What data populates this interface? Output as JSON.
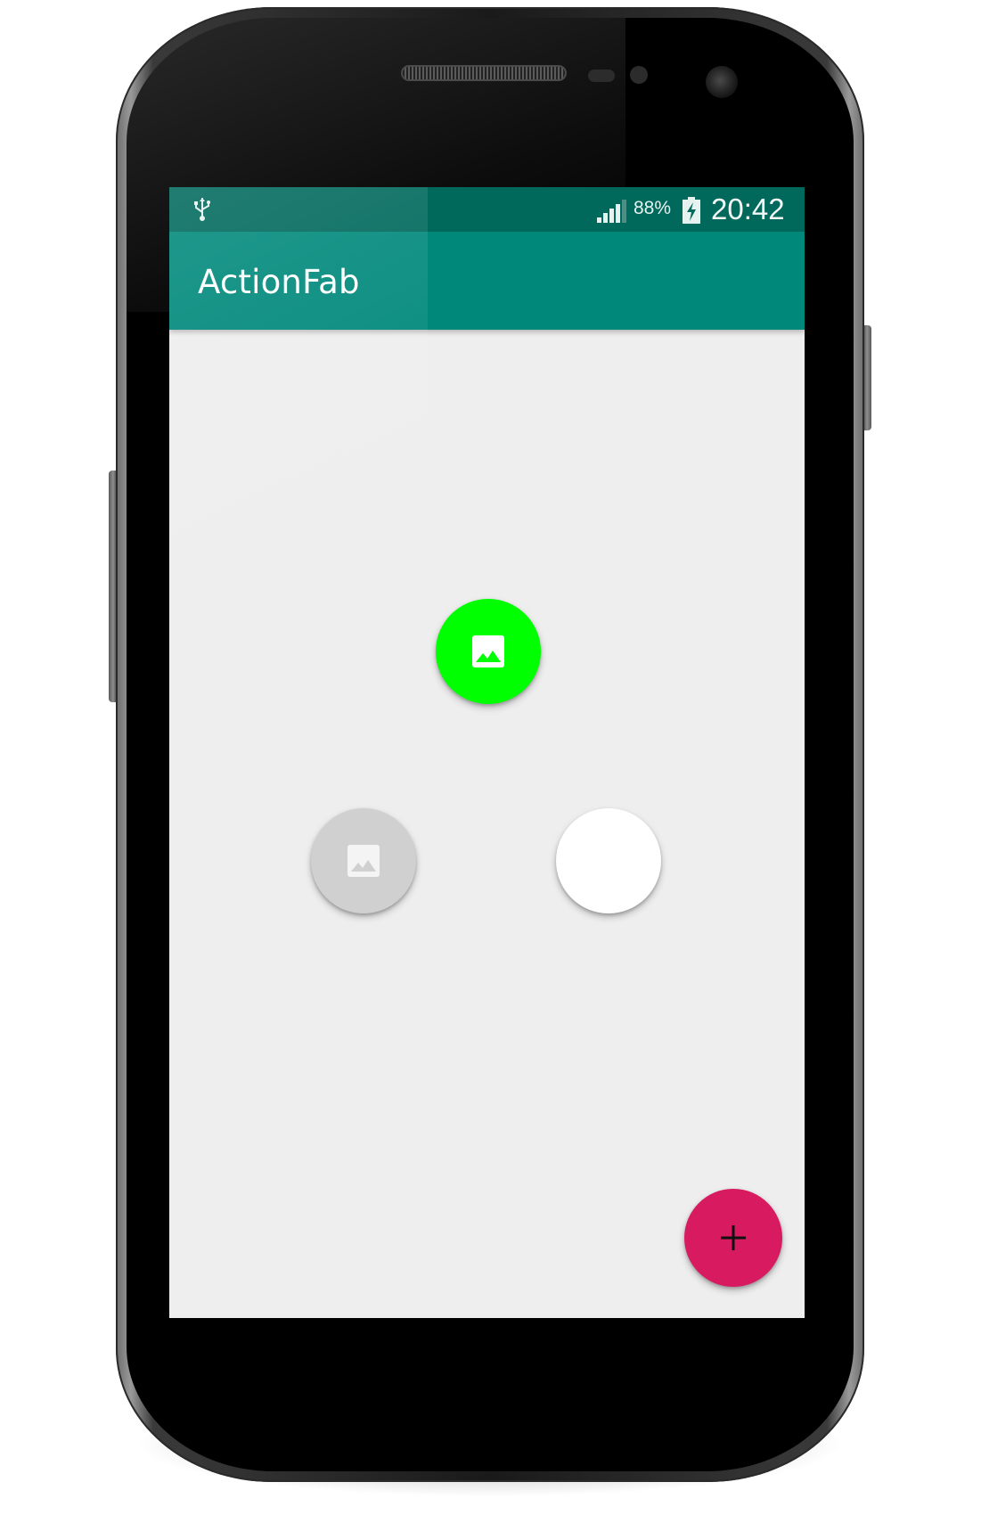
{
  "status_bar": {
    "battery_percent": "88%",
    "time": "20:42",
    "icons": [
      "usb-icon",
      "signal-icon",
      "battery-charging-icon"
    ]
  },
  "app_bar": {
    "title": "ActionFab"
  },
  "actions": [
    {
      "name": "image-action",
      "icon": "image-icon",
      "color": "#00ff00"
    },
    {
      "name": "image-action-disabled",
      "icon": "image-icon",
      "color": "#d0d0d0"
    },
    {
      "name": "blank-action",
      "icon": "",
      "color": "#ffffff"
    }
  ],
  "main_fab": {
    "icon": "plus-icon",
    "color": "#d81b60"
  },
  "colors": {
    "status_bar": "#00695c",
    "app_bar": "#00897b",
    "background": "#eeeeee"
  }
}
